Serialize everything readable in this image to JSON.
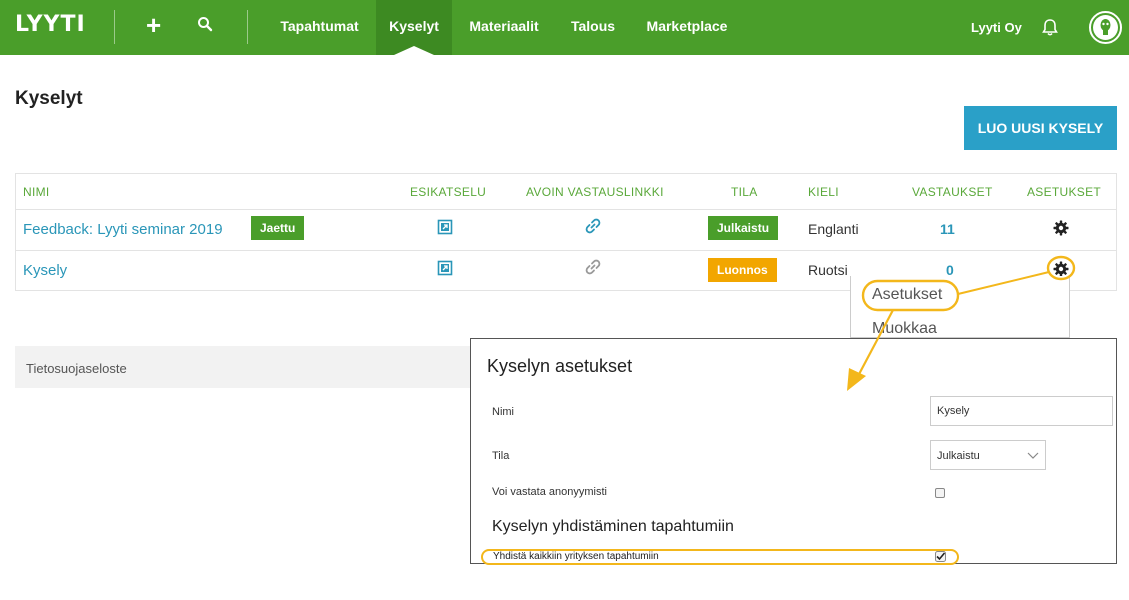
{
  "nav": {
    "logo": "LYYTI",
    "items": [
      {
        "label": "Tapahtumat"
      },
      {
        "label": "Kyselyt"
      },
      {
        "label": "Materiaalit"
      },
      {
        "label": "Talous"
      },
      {
        "label": "Marketplace"
      }
    ],
    "org_name": "Lyyti Oy",
    "active_item": "Kyselyt",
    "icons": [
      "plus-icon",
      "search-icon",
      "bell-icon",
      "avatar-icon"
    ]
  },
  "page": {
    "title": "Kyselyt",
    "create_button": "LUO UUSI KYSELY"
  },
  "table": {
    "headers": {
      "name": "NIMI",
      "preview": "ESIKATSELU",
      "open_link": "AVOIN VASTAUSLINKKI",
      "state": "TILA",
      "language": "KIELI",
      "responses": "VASTAUKSET",
      "settings": "ASETUKSET"
    },
    "rows": [
      {
        "name": "Feedback: Lyyti seminar 2019",
        "badge": "Jaettu",
        "state": "Julkaistu",
        "language": "Englanti",
        "responses": "11"
      },
      {
        "name": "Kysely",
        "badge": "",
        "state": "Luonnos",
        "language": "Ruotsi",
        "responses": "0"
      }
    ]
  },
  "dropdown": {
    "items": [
      "Asetukset",
      "Muokkaa"
    ]
  },
  "footer": {
    "privacy": "Tietosuojaseloste"
  },
  "settings_panel": {
    "title": "Kyselyn asetukset",
    "name_label": "Nimi",
    "name_value": "Kysely",
    "state_label": "Tila",
    "state_value": "Julkaistu",
    "anonymous_label": "Voi vastata anonyymisti",
    "anonymous_checked": false,
    "section_title": "Kyselyn yhdistäminen tapahtumiin",
    "connect_all_label": "Yhdistä kaikkiin yrityksen tapahtumiin",
    "connect_all_checked": true
  },
  "colors": {
    "nav_green": "#4a9e2a",
    "active_green": "#3d8a22",
    "link_blue": "#2a96b8",
    "button_blue": "#2aa0c8",
    "draft_orange": "#f2a600",
    "annotation_yellow": "#f3b71b"
  }
}
